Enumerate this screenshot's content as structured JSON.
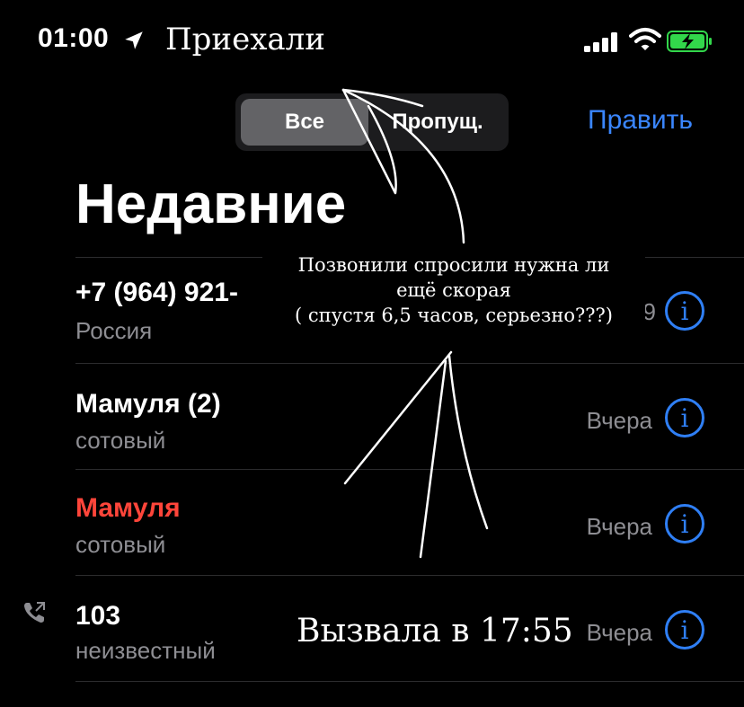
{
  "status_bar": {
    "time": "01:00",
    "icons": [
      "location-arrow-icon",
      "cellular-signal-icon",
      "wifi-icon",
      "battery-charging-icon"
    ]
  },
  "annotations": {
    "top_note": "Приехали",
    "middle_note_lines": [
      "Позвонили спросили нужна ли",
      "ещё скорая",
      "( спустя 6,5 часов, серьезно???)"
    ],
    "bottom_note": "Вызвала в 17:55"
  },
  "segmented_control": {
    "all_label": "Все",
    "missed_label": "Пропущ."
  },
  "header": {
    "edit_label": "Править",
    "title": "Недавние"
  },
  "calls": [
    {
      "name": "+7 (964) 921-",
      "subtitle": "Россия",
      "date": "9",
      "missed": false
    },
    {
      "name": "Мамуля (2)",
      "subtitle": "сотовый",
      "date": "Вчера",
      "missed": false
    },
    {
      "name": "Мамуля",
      "subtitle": "сотовый",
      "date": "Вчера",
      "missed": true
    },
    {
      "name": "103",
      "subtitle": "неизвестный",
      "date": "Вчера",
      "missed": false,
      "outgoing_icon": "outgoing-call-icon"
    }
  ],
  "info_glyph": "i",
  "colors": {
    "background": "#000000",
    "accent_blue": "#3a86ff",
    "missed_red": "#ff453a",
    "secondary_gray": "#8e8e93",
    "battery_green": "#32d74b"
  }
}
